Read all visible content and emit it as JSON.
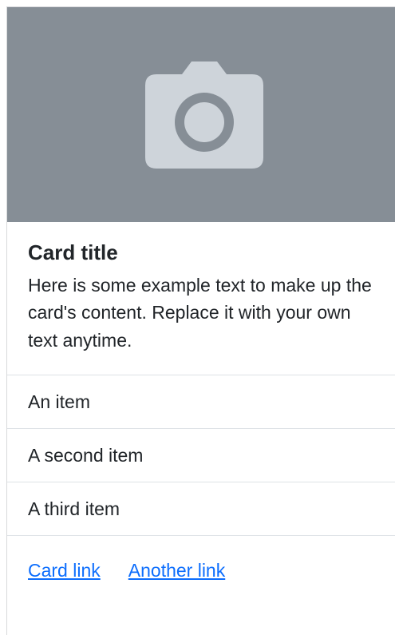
{
  "card": {
    "image": {
      "icon": "camera-icon",
      "background": "#868e96",
      "icon_color": "#ced4da"
    },
    "title": "Card title",
    "text": "Here is some example text to make up the card's content. Replace it with your own text anytime.",
    "items": [
      {
        "label": "An item"
      },
      {
        "label": "A second item"
      },
      {
        "label": "A third item"
      }
    ],
    "links": [
      {
        "label": "Card link"
      },
      {
        "label": "Another link"
      }
    ],
    "link_color": "#0d6efd"
  }
}
